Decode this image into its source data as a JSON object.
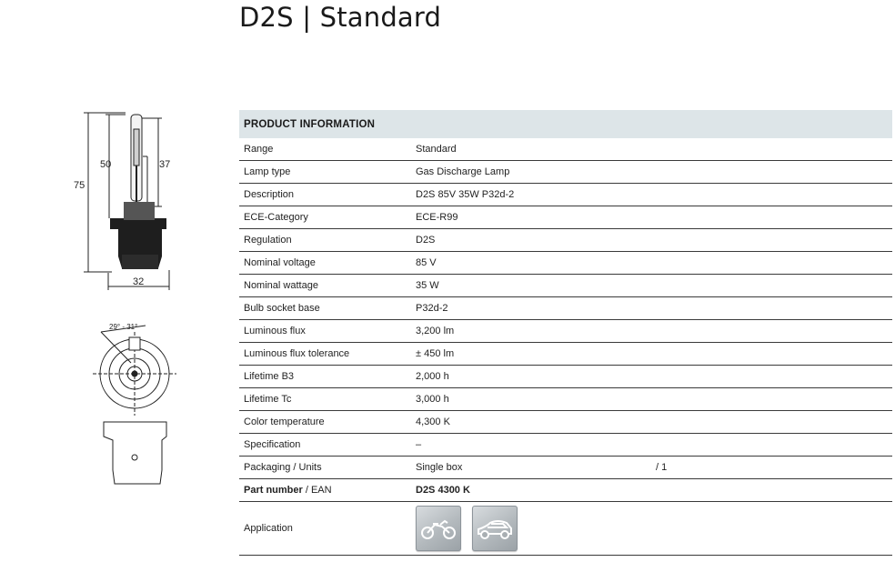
{
  "title": "D2S | Standard",
  "dimensions": {
    "d75": "75",
    "d50": "50",
    "d37": "37",
    "d32": "32",
    "angle": "29° - 31°"
  },
  "table": {
    "header": "PRODUCT INFORMATION",
    "rows": [
      {
        "label": "Range",
        "value": "Standard",
        "extra": ""
      },
      {
        "label": "Lamp type",
        "value": "Gas Discharge Lamp",
        "extra": ""
      },
      {
        "label": "Description",
        "value": "D2S 85V 35W P32d-2",
        "extra": ""
      },
      {
        "label": "ECE-Category",
        "value": "ECE-R99",
        "extra": ""
      },
      {
        "label": "Regulation",
        "value": "D2S",
        "extra": ""
      },
      {
        "label": "Nominal voltage",
        "value": "85 V",
        "extra": ""
      },
      {
        "label": "Nominal wattage",
        "value": "35 W",
        "extra": ""
      },
      {
        "label": "Bulb socket base",
        "value": "P32d-2",
        "extra": ""
      },
      {
        "label": "Luminous flux",
        "value": "3,200 lm",
        "extra": ""
      },
      {
        "label": "Luminous flux tolerance",
        "value": "± 450 lm",
        "extra": ""
      },
      {
        "label": "Lifetime B3",
        "value": "2,000 h",
        "extra": ""
      },
      {
        "label": "Lifetime Tc",
        "value": "3,000 h",
        "extra": ""
      },
      {
        "label": "Color temperature",
        "value": "4,300 K",
        "extra": ""
      },
      {
        "label": "Specification",
        "value": "–",
        "extra": ""
      },
      {
        "label": "Packaging / Units",
        "value": "Single box",
        "extra": "/ 1"
      }
    ],
    "part": {
      "label_bold": "Part number",
      "label_rest": " / EAN",
      "value": "D2S 4300 K"
    },
    "application": {
      "label": "Application",
      "icons": [
        "motorcycle-icon",
        "car-icon"
      ]
    }
  },
  "colors": {
    "header_bg": "#dde5e8",
    "rule": "#3a3a3a",
    "icon_bg": "#b3b9bd"
  }
}
